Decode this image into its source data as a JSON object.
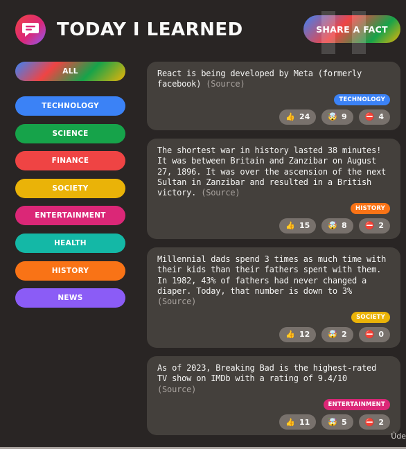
{
  "header": {
    "title": "Today I Learned",
    "share_label": "Share a fact"
  },
  "sidebar": {
    "all_label": "All",
    "categories": [
      {
        "label": "Technology",
        "color": "#3b82f6"
      },
      {
        "label": "Science",
        "color": "#16a34a"
      },
      {
        "label": "Finance",
        "color": "#ef4444"
      },
      {
        "label": "Society",
        "color": "#eab308"
      },
      {
        "label": "Entertainment",
        "color": "#db2777"
      },
      {
        "label": "Health",
        "color": "#14b8a6"
      },
      {
        "label": "History",
        "color": "#f97316"
      },
      {
        "label": "News",
        "color": "#8b5cf6"
      }
    ]
  },
  "facts": [
    {
      "text": "React is being developed by Meta (formerly facebook)",
      "source": "(Source)",
      "tag": "Technology",
      "tag_color": "#3b82f6",
      "votes": {
        "like": "24",
        "mindblown": "9",
        "false": "4"
      }
    },
    {
      "text": "The shortest war in history lasted 38 minutes! It was between Britain and Zanzibar on August 27, 1896. It was over the ascension of the next Sultan in Zanzibar and resulted in a British victory.",
      "source": "(Source)",
      "tag": "History",
      "tag_color": "#f97316",
      "votes": {
        "like": "15",
        "mindblown": "8",
        "false": "2"
      }
    },
    {
      "text": "Millennial dads spend 3 times as much time with their kids than their fathers spent with them. In 1982, 43% of fathers had never changed a diaper. Today, that number is down to 3%",
      "source": "(Source)",
      "tag": "Society",
      "tag_color": "#eab308",
      "votes": {
        "like": "12",
        "mindblown": "2",
        "false": "0"
      }
    },
    {
      "text": "As of 2023, Breaking Bad is the highest-rated TV show on IMDb with a rating of 9.4/10",
      "source": "(Source)",
      "tag": "Entertainment",
      "tag_color": "#db2777",
      "votes": {
        "like": "11",
        "mindblown": "5",
        "false": "2"
      }
    }
  ],
  "icons": {
    "like": "thumbs-up-icon",
    "mindblown": "mind-blown-icon",
    "false": "no-entry-icon",
    "logo": "chat-bubble-icon"
  },
  "misc": {
    "corner_text": "Ûde"
  }
}
